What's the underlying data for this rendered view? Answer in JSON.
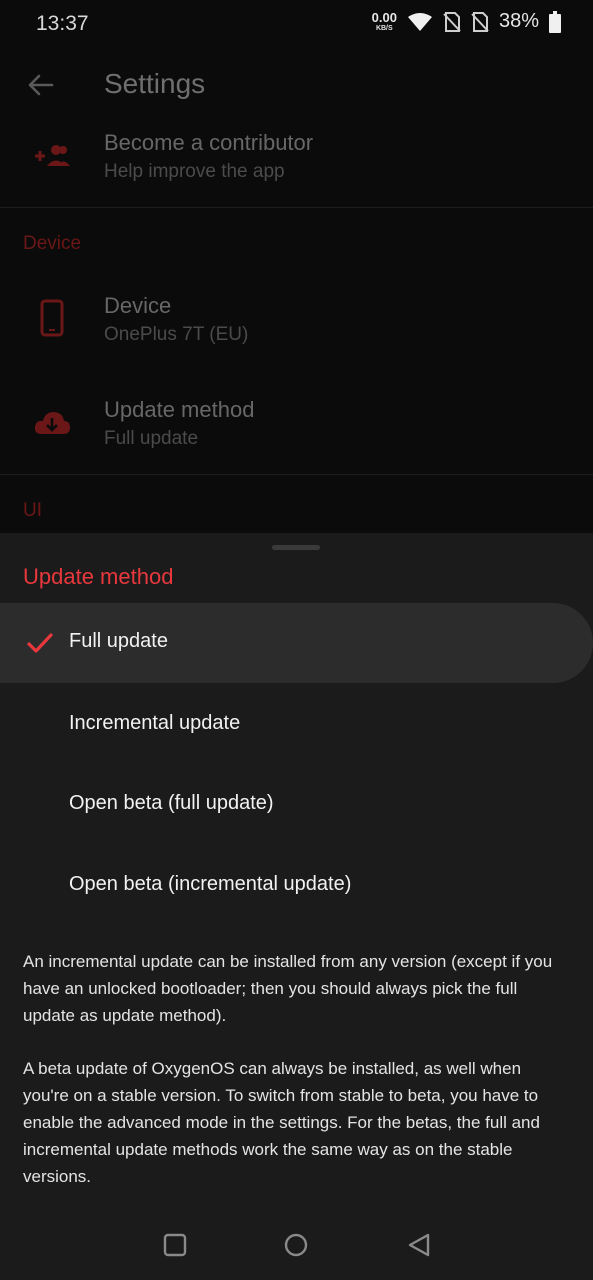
{
  "status_bar": {
    "time": "13:37",
    "net_speed_value": "0.00",
    "net_speed_unit": "KB/S",
    "battery": "38%",
    "icons": [
      "wifi-icon",
      "no-sim-icon",
      "no-sim-icon",
      "battery-icon"
    ]
  },
  "appbar": {
    "title": "Settings",
    "back_icon": "arrow-back-icon"
  },
  "contributor": {
    "title": "Become a contributor",
    "subtitle": "Help improve the app",
    "icon": "group-add-icon"
  },
  "device_section": {
    "header": "Device",
    "device": {
      "title": "Device",
      "subtitle": "OnePlus 7T (EU)",
      "icon": "phone-icon"
    },
    "update_method": {
      "title": "Update method",
      "subtitle": "Full update",
      "icon": "cloud-download-icon"
    }
  },
  "ui_section": {
    "header": "UI"
  },
  "sheet": {
    "title": "Update method",
    "options": [
      {
        "label": "Full update",
        "selected": true
      },
      {
        "label": "Incremental update",
        "selected": false
      },
      {
        "label": "Open beta (full update)",
        "selected": false
      },
      {
        "label": "Open beta (incremental update)",
        "selected": false
      }
    ],
    "description_1": "An incremental update can be installed from any version (except if you have an unlocked bootloader; then you should always pick the full update as update method).",
    "description_2": "A beta update of OxygenOS can always be installed, as well when you're on a stable version. To switch from stable to beta, you have to enable the advanced mode in the settings. For the betas, the full and incremental update methods work the same way as on the stable versions."
  },
  "navbar": {
    "buttons": [
      "recents-icon",
      "home-icon",
      "back-icon"
    ]
  },
  "colors": {
    "accent": "#e8383d",
    "sheet_bg": "#1b1b1b",
    "dim_bg": "#0b0b0b"
  }
}
